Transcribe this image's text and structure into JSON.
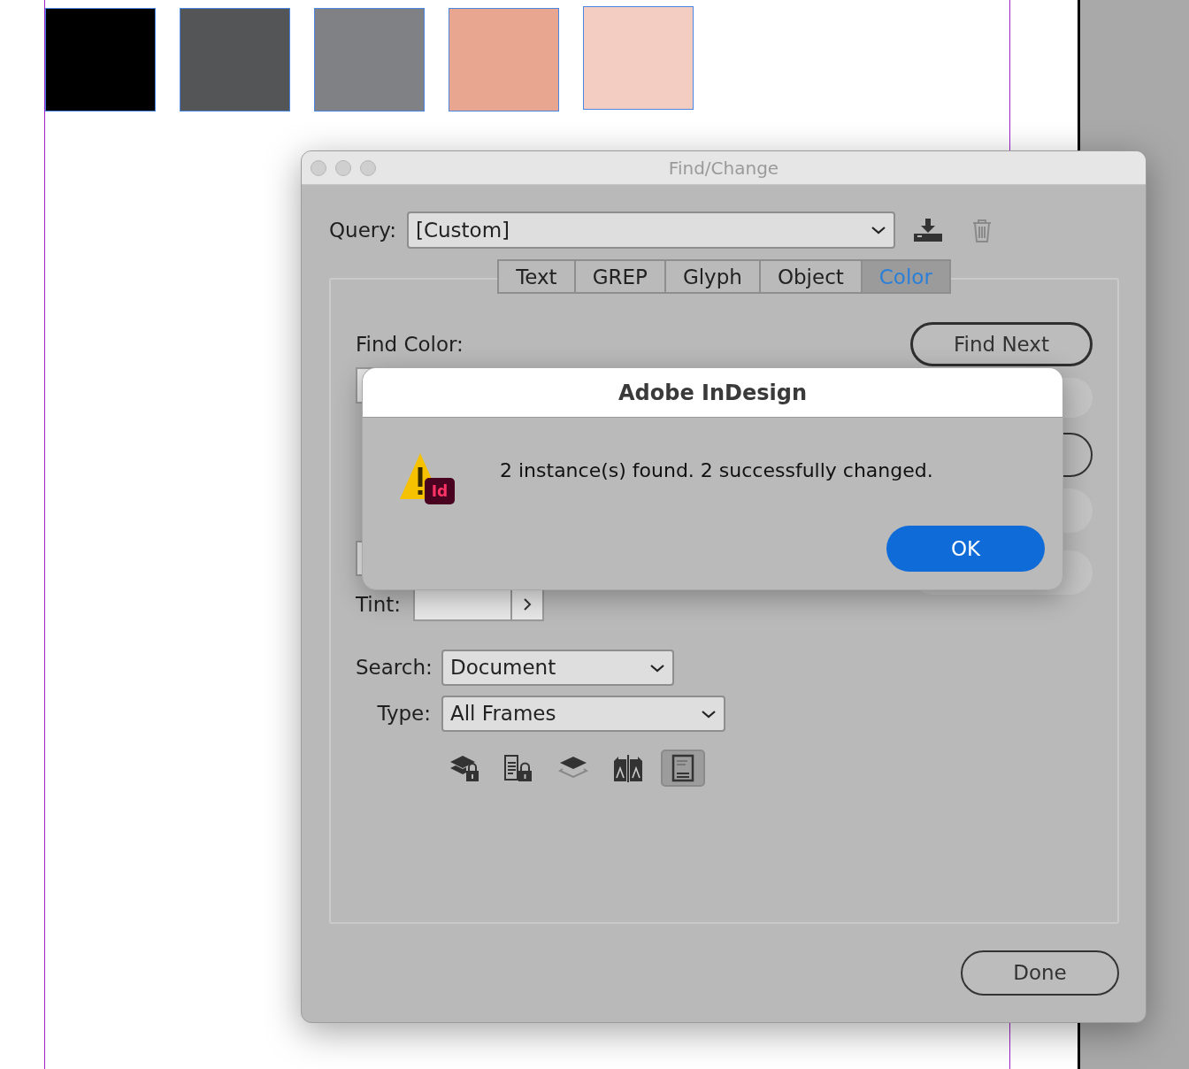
{
  "swatches": [
    {
      "color": "#000000"
    },
    {
      "color": "#545557"
    },
    {
      "color": "#808184"
    },
    {
      "color": "#e8a690"
    },
    {
      "color": "#f3cdc1"
    }
  ],
  "dialog": {
    "title": "Find/Change",
    "query": {
      "label": "Query:",
      "value": "[Custom]"
    },
    "tabs": [
      {
        "label": "Text",
        "selected": false
      },
      {
        "label": "GREP",
        "selected": false
      },
      {
        "label": "Glyph",
        "selected": false
      },
      {
        "label": "Object",
        "selected": false
      },
      {
        "label": "Color",
        "selected": true
      }
    ],
    "find_color_label": "Find Color:",
    "tint_label": "Tint:",
    "search": {
      "label": "Search:",
      "value": "Document"
    },
    "type": {
      "label": "Type:",
      "value": "All Frames"
    },
    "options": [
      {
        "kind": "locked-layers",
        "selected": false
      },
      {
        "kind": "locked-stories",
        "selected": false
      },
      {
        "kind": "hidden-layers",
        "selected": false
      },
      {
        "kind": "master-pages",
        "selected": false
      },
      {
        "kind": "footnotes",
        "selected": true
      }
    ],
    "find_next": "Find Next",
    "side_buttons": [
      {
        "disabled": true
      },
      {
        "disabled": false
      },
      {
        "disabled": true
      },
      {
        "disabled": true
      }
    ],
    "done": "Done"
  },
  "alert": {
    "title": "Adobe InDesign",
    "message": "2 instance(s) found. 2 successfully changed.",
    "badge": "Id",
    "button": "OK"
  }
}
